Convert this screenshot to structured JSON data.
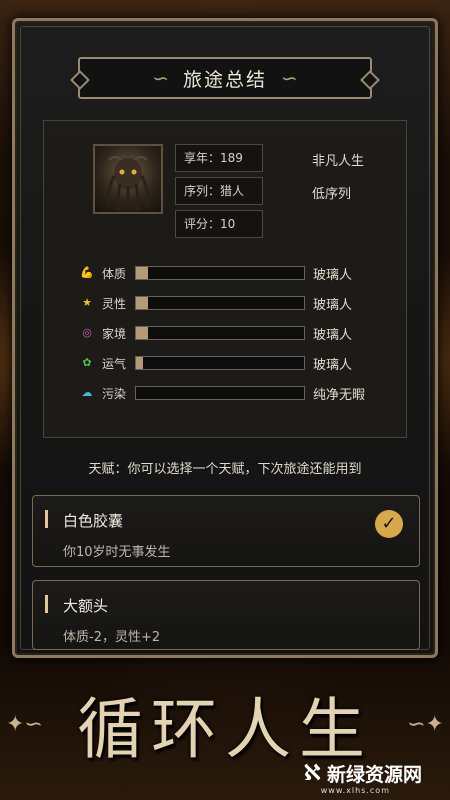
{
  "header": {
    "title": "旅途总结"
  },
  "character": {
    "age": "享年：189",
    "sequence": "序列：猎人",
    "score": "评分：10",
    "note_age": "非凡人生",
    "note_sequence": "低序列"
  },
  "attributes": [
    {
      "icon": "muscle-icon",
      "label": "体质",
      "value": "玻璃人",
      "fill": 0.07,
      "color": "#e08a3a"
    },
    {
      "icon": "star-icon",
      "label": "灵性",
      "value": "玻璃人",
      "fill": 0.07,
      "color": "#e8c23c"
    },
    {
      "icon": "swirl-icon",
      "label": "家境",
      "value": "玻璃人",
      "fill": 0.07,
      "color": "#d25ab8"
    },
    {
      "icon": "clover-icon",
      "label": "运气",
      "value": "玻璃人",
      "fill": 0.04,
      "color": "#4fc24a"
    },
    {
      "icon": "cloud-icon",
      "label": "污染",
      "value": "纯净无暇",
      "fill": 0.0,
      "color": "#4ab8d8"
    }
  ],
  "talent_hint": "天赋：你可以选择一个天赋，下次旅途还能用到",
  "talents": [
    {
      "name": "白色胶囊",
      "desc": "你10岁时无事发生",
      "selected": true
    },
    {
      "name": "大额头",
      "desc": "体质-2，灵性+2",
      "selected": false
    }
  ],
  "banner": "循环人生",
  "watermark": {
    "name": "新绿资源网",
    "url": "www.xlhs.com"
  }
}
